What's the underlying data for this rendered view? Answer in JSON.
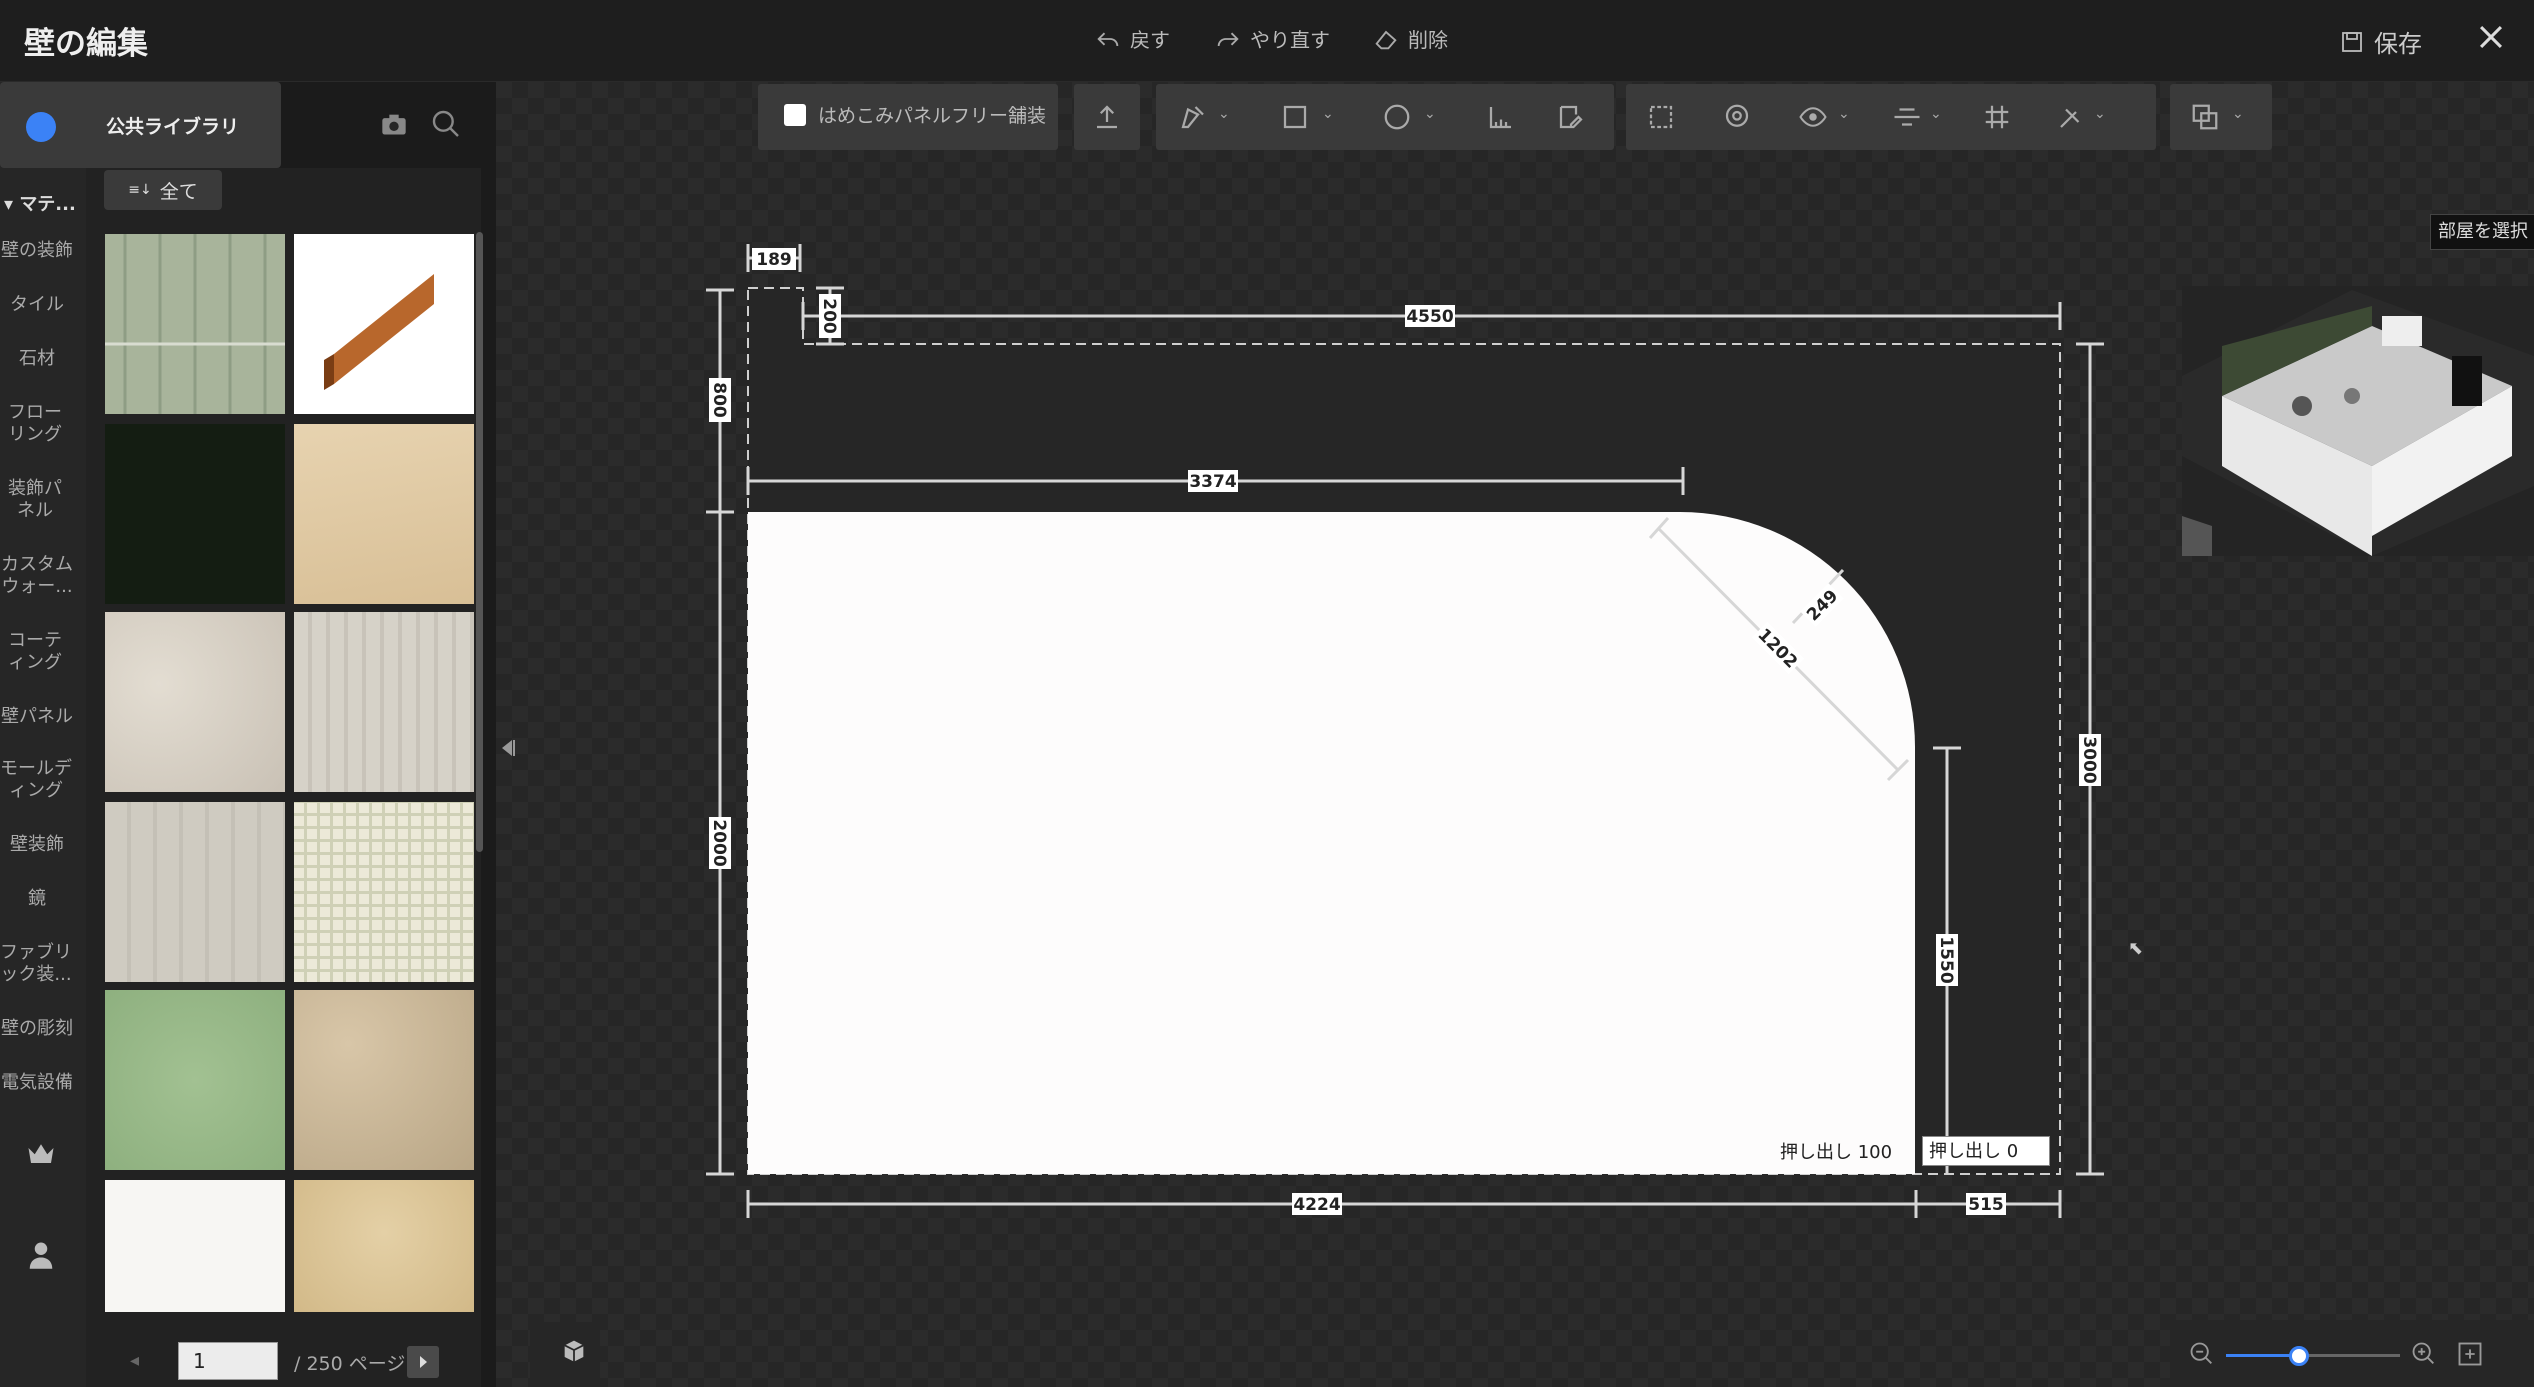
{
  "header": {
    "title": "壁の編集",
    "undo_label": "戻す",
    "redo_label": "やり直す",
    "delete_label": "削除",
    "save_label": "保存"
  },
  "library": {
    "source_label": "公共ライブラリ",
    "filter_label": "全て",
    "section_label": "マテ...",
    "categories": [
      "壁の装飾",
      "タイル",
      "石材",
      "フローリング",
      "装飾パネル",
      "カスタムウォー...",
      "コーティング",
      "壁パネル",
      "モールディング",
      "壁装飾",
      "鏡",
      "ファブリック装...",
      "壁の彫刻",
      "電気設備"
    ],
    "thumbnails": [
      {
        "name": "green-wood-panel",
        "color": "#a9b59c"
      },
      {
        "name": "wood-baseboard",
        "color": "#b8672c"
      },
      {
        "name": "dark-green-solid",
        "color": "#141d12"
      },
      {
        "name": "light-oak",
        "color": "#dfc9a4"
      },
      {
        "name": "beige-stone-tile",
        "color": "#d6d0c6"
      },
      {
        "name": "grey-wood",
        "color": "#d4d0c7"
      },
      {
        "name": "light-grey-wood",
        "color": "#ccc8be"
      },
      {
        "name": "checked-fabric",
        "color": "#e7e5d3"
      },
      {
        "name": "sage-green-plaster",
        "color": "#98b888"
      },
      {
        "name": "camo-stone",
        "color": "#cbb99b"
      },
      {
        "name": "white-speckle",
        "color": "#f7f6f3"
      },
      {
        "name": "gold-damask",
        "color": "#dcc49a"
      }
    ],
    "pager": {
      "current_page": "1",
      "total_label": "/ 250 ページ"
    }
  },
  "toolbar": {
    "paving_label": "はめこみパネルフリー舗装"
  },
  "drawing": {
    "dimensions": {
      "d189": "189",
      "d200": "200",
      "d4550": "4550",
      "d800": "800",
      "d3374": "3374",
      "d249": "249",
      "d1202": "1202",
      "d3000": "3000",
      "d2000": "2000",
      "d1550": "1550",
      "d4224": "4224",
      "d515": "515"
    },
    "extrude_a": "押し出し  100",
    "extrude_b": "押し出し  0"
  },
  "right_panel": {
    "select_room_label": "部屋を選択"
  },
  "zoom": {
    "level": 0.42
  },
  "colors": {
    "accent": "#3b82f6",
    "panel": "#3a3a3a",
    "canvas": "#2b2b2b"
  }
}
